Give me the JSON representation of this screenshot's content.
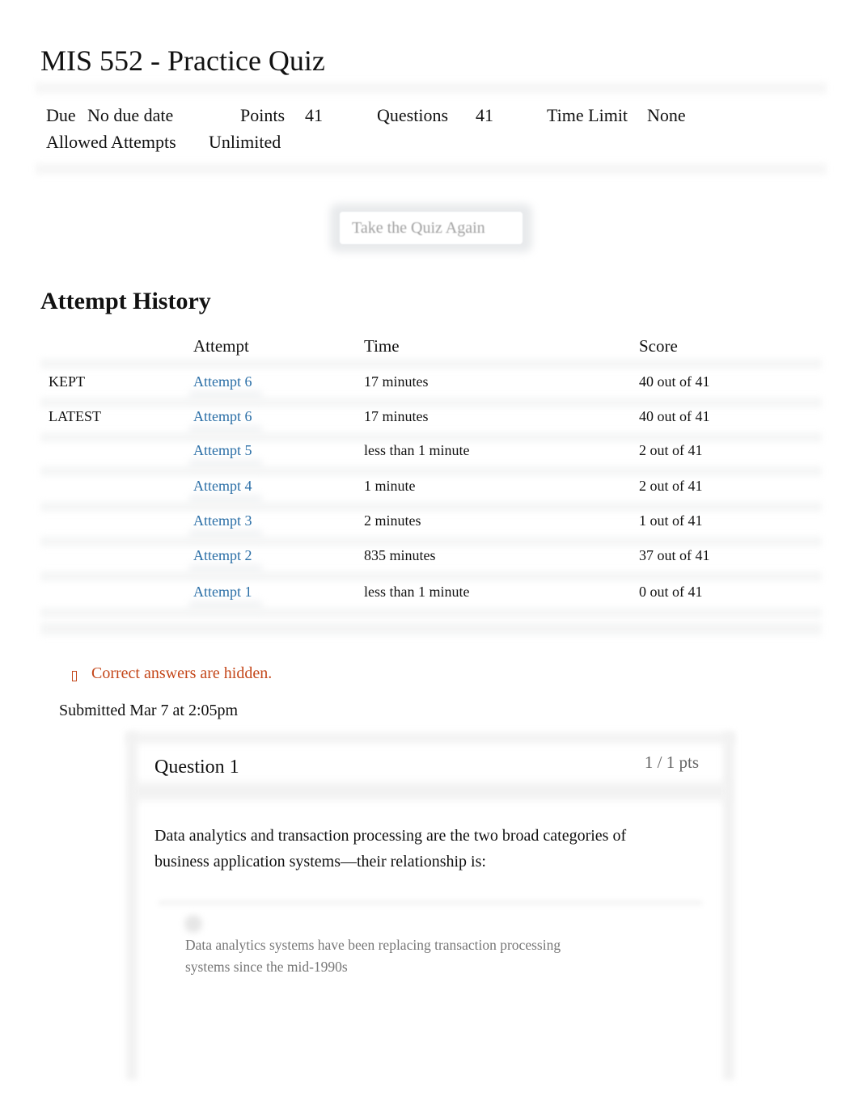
{
  "page": {
    "title": "MIS 552 - Practice Quiz"
  },
  "details": {
    "due_label": "Due",
    "due_value": "No due date",
    "points_label": "Points",
    "points_value": "41",
    "questions_label": "Questions",
    "questions_value": "41",
    "time_limit_label": "Time Limit",
    "time_limit_value": "None",
    "allowed_attempts_label": "Allowed Attempts",
    "allowed_attempts_value": "Unlimited"
  },
  "actions": {
    "take_again_label": "Take the Quiz Again"
  },
  "attempt_history": {
    "title": "Attempt History",
    "columns": [
      "",
      "Attempt",
      "Time",
      "Score"
    ],
    "rows": [
      {
        "tag": "KEPT",
        "attempt": "Attempt 6",
        "time": "17 minutes",
        "score": "40 out of 41"
      },
      {
        "tag": "LATEST",
        "attempt": "Attempt 6",
        "time": "17 minutes",
        "score": "40 out of 41"
      },
      {
        "tag": "",
        "attempt": "Attempt 5",
        "time": "less than 1 minute",
        "score": "2 out of 41"
      },
      {
        "tag": "",
        "attempt": "Attempt 4",
        "time": "1 minute",
        "score": "2 out of 41"
      },
      {
        "tag": "",
        "attempt": "Attempt 3",
        "time": "2 minutes",
        "score": "1 out of 41"
      },
      {
        "tag": "",
        "attempt": "Attempt 2",
        "time": "835 minutes",
        "score": "37 out of 41"
      },
      {
        "tag": "",
        "attempt": "Attempt 1",
        "time": "less than 1 minute",
        "score": "0 out of 41"
      }
    ]
  },
  "notice": {
    "icon": "warning-icon",
    "text": "Correct answers are hidden.",
    "color": "#c4471a"
  },
  "submission": {
    "text": "Submitted Mar 7 at 2:05pm"
  },
  "question": {
    "title": "Question 1",
    "points": "1 / 1 pts",
    "text": "Data analytics and transaction processing are the two broad categories of business application systems—their relationship is:",
    "answers": [
      {
        "text": "Data analytics systems have been replacing transaction processing systems since the mid-1990s"
      }
    ]
  },
  "colors": {
    "link": "#2a6ea6",
    "text": "#111111",
    "muted": "#777777"
  }
}
